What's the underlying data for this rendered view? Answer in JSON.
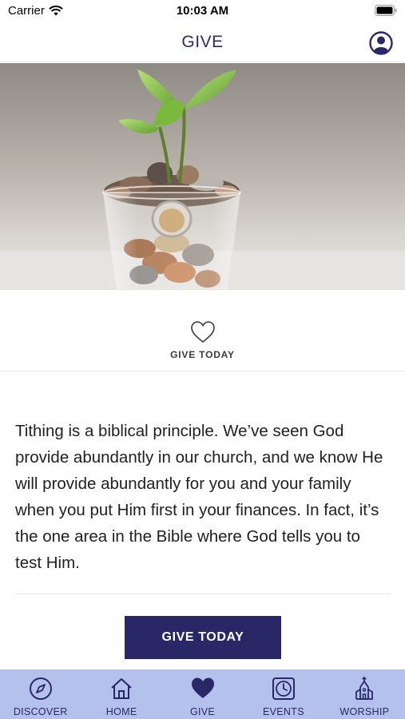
{
  "status_bar": {
    "carrier": "Carrier",
    "time": "10:03 AM"
  },
  "header": {
    "title": "GIVE"
  },
  "give_link": {
    "label": "GIVE TODAY"
  },
  "content": {
    "paragraph": "Tithing is a biblical principle. We’ve seen God provide abundantly in our church, and we know He will provide abundantly for you and your family when you put Him first in your finances. In fact, it’s the one area in the Bible where God tells you to test Him."
  },
  "cta": {
    "label": "GIVE TODAY"
  },
  "tabs": [
    {
      "label": "DISCOVER",
      "icon": "compass-icon"
    },
    {
      "label": "HOME",
      "icon": "house-icon"
    },
    {
      "label": "GIVE",
      "icon": "heart-icon"
    },
    {
      "label": "EVENTS",
      "icon": "clock-icon"
    },
    {
      "label": "WORSHIP",
      "icon": "church-icon"
    }
  ],
  "colors": {
    "brand": "#2a2766",
    "tab_bar": "#b4c1ed"
  }
}
